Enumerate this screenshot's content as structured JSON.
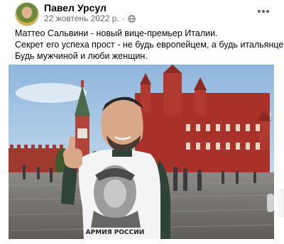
{
  "post": {
    "author": "Павел Урсул",
    "date": "22 жовтень 2022 р.",
    "separator": "·",
    "audience_icon": "globe-icon",
    "more_icon": "more-horizontal-icon",
    "text_lines": [
      "Маттео Сальвини - новый вице-премьер Италии.",
      "Секрет его успеха прост - не будь европейцем, а будь итальянцем.",
      "Будь мужчиной и люби женщин."
    ]
  },
  "photo": {
    "shirt_text": "АРМИЯ РОССИИ"
  },
  "colors": {
    "name": "#050505",
    "meta": "#65676b",
    "sky": "#b8d3ec",
    "museum_red": "#a8322a",
    "shirt": "#f4f4f4"
  }
}
